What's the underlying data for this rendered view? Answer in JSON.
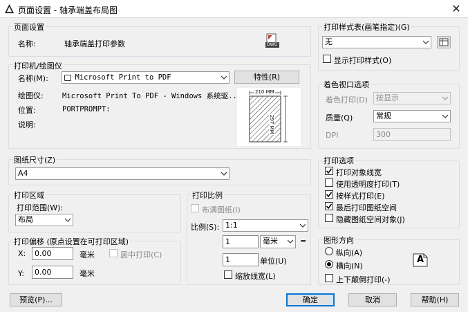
{
  "window": {
    "title": "页面设置 - 轴承端盖布局图",
    "close_glyph": "✕"
  },
  "page_setup": {
    "legend": "页面设置",
    "name_label": "名称:",
    "name_value": "轴承端盖打印参数",
    "dwg_icon_text": "DWG"
  },
  "plotter": {
    "legend": "打印机/绘图仪",
    "name_label": "名称(M):",
    "name_value": "Microsoft Print to PDF",
    "properties_button": "特性(R)",
    "plotter_label": "绘图仪:",
    "plotter_value": "Microsoft Print To PDF - Windows 系统驱...",
    "location_label": "位置:",
    "location_value": "PORTPROMPT:",
    "description_label": "说明:",
    "preview": {
      "width_label": "210 MM",
      "height_label": "297 MM"
    }
  },
  "paper_size": {
    "legend": "图纸尺寸(Z)",
    "value": "A4"
  },
  "plot_area": {
    "legend": "打印区域",
    "range_label": "打印范围(W):",
    "range_value": "布局"
  },
  "plot_offset": {
    "legend": "打印偏移 (原点设置在可打印区域)",
    "x_label": "X:",
    "x_value": "0.00",
    "x_unit": "毫米",
    "y_label": "Y:",
    "y_value": "0.00",
    "y_unit": "毫米",
    "center_label": "居中打印(C)"
  },
  "plot_scale": {
    "legend": "打印比例",
    "fit_label": "布满图纸(I)",
    "scale_label": "比例(S):",
    "scale_value": "1:1",
    "value1": "1",
    "unit_value": "毫米",
    "equals": "=",
    "value2": "1",
    "unit_label": "单位(U)",
    "scale_lineweights_label": "缩放线宽(L)"
  },
  "plot_style_table": {
    "legend": "打印样式表(画笔指定)(G)",
    "value": "无",
    "display_label": "显示打印样式(O)"
  },
  "shaded_viewport": {
    "legend": "着色视口选项",
    "shade_label": "着色打印(D)",
    "shade_value": "按显示",
    "quality_label": "质量(Q)",
    "quality_value": "常规",
    "dpi_label": "DPI",
    "dpi_value": "300"
  },
  "plot_options": {
    "legend": "打印选项",
    "items": [
      {
        "label": "打印对象线宽",
        "checked": true
      },
      {
        "label": "使用透明度打印(T)",
        "checked": false
      },
      {
        "label": "按样式打印(E)",
        "checked": true
      },
      {
        "label": "最后打印图纸空间",
        "checked": true
      },
      {
        "label": "隐藏图纸空间对象(J)",
        "checked": false
      }
    ]
  },
  "orientation": {
    "legend": "图形方向",
    "portrait_label": "纵向(A)",
    "landscape_label": "横向(N)",
    "upside_down_label": "上下颠倒打印(-)",
    "selected": "landscape",
    "icon_letter": "A"
  },
  "footer": {
    "preview_button": "预览(P)...",
    "ok_button": "确定",
    "cancel_button": "取消",
    "help_button": "帮助(H)"
  }
}
